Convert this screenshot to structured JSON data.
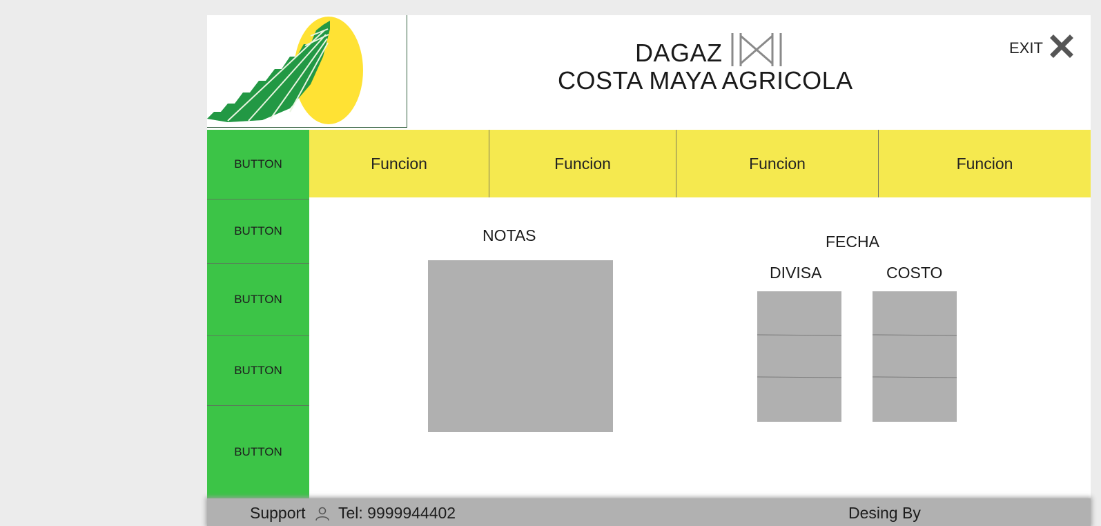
{
  "header": {
    "title_line1": "DAGAZ",
    "title_line2": "COSTA MAYA AGRICOLA",
    "brand_icon": "dagaz-rune-icon",
    "exit_label": "EXIT",
    "exit_icon": "close-icon"
  },
  "logo": {
    "icon": "agricola-logo"
  },
  "colors": {
    "sidebar": "#3cc447",
    "topbar": "#f5e94f",
    "placeholder": "#b0b0b0",
    "footer": "#b1b1b1"
  },
  "sidebar": {
    "items": [
      {
        "label": "BUTTON"
      },
      {
        "label": "BUTTON"
      },
      {
        "label": "BUTTON"
      },
      {
        "label": "BUTTON"
      },
      {
        "label": "BUTTON"
      }
    ]
  },
  "tabs": [
    {
      "label": "Funcion"
    },
    {
      "label": "Funcion"
    },
    {
      "label": "Funcion"
    },
    {
      "label": "Funcion"
    }
  ],
  "main": {
    "notas_label": "NOTAS",
    "fecha_label": "FECHA",
    "divisa_label": "DIVISA",
    "costo_label": "COSTO"
  },
  "footer": {
    "support_label": "Support",
    "user_icon": "user-icon",
    "tel_label": "Tel: 9999944402",
    "design_label": "Desing By"
  }
}
